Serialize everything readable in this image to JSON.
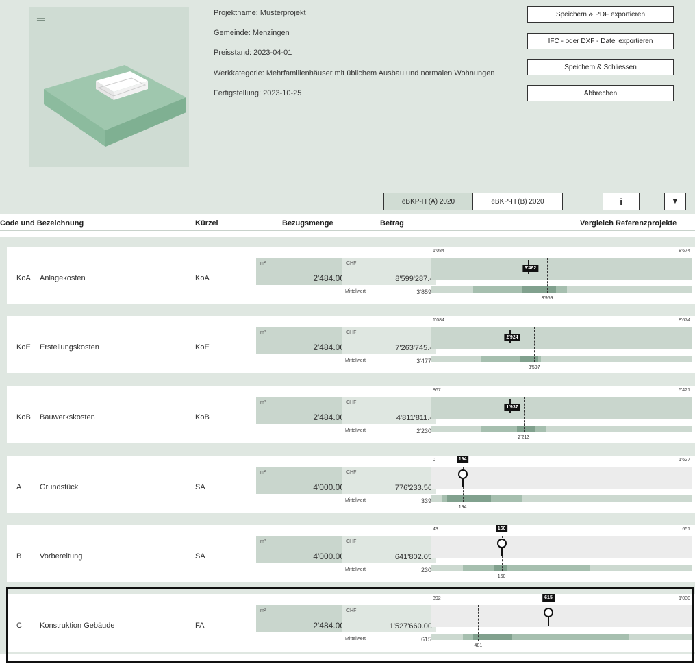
{
  "project": {
    "name_line": "Projektname: Musterprojekt",
    "municipality_line": "Gemeinde: Menzingen",
    "price_line": "Preisstand: 2023-04-01",
    "category_line": "Werkkategorie: Mehrfamilienhäuser mit üblichem Ausbau und normalen Wohnungen",
    "completion_line": "Fertigstellung: 2023-10-25"
  },
  "actions": {
    "save_pdf": "Speichern & PDF exportieren",
    "export_ifc": "IFC - oder DXF - Datei exportieren",
    "save_close": "Speichern & Schliessen",
    "cancel": "Abbrechen"
  },
  "tabs": {
    "a": "eBKP-H (A) 2020",
    "b": "eBKP-H (B) 2020"
  },
  "icons": {
    "info": "i",
    "filter": "▼",
    "menu": "═"
  },
  "columns": {
    "code": "Code und Bezeichnung",
    "abbr": "Kürzel",
    "qty": "Bezugsmenge",
    "amount": "Betrag",
    "compare": "Vergleich Referenzprojekte"
  },
  "rows": [
    {
      "code": "KoA",
      "name": "Anlagekosten",
      "abbr": "KoA",
      "qty_unit": "m²",
      "qty": "2'484.00",
      "currency": "CHF",
      "amount": "8'599'287.-",
      "mean_label": "Mittelwert",
      "mean": "3'859",
      "min": "1'084",
      "max": "8'674",
      "value": "3'462",
      "median": "3'959",
      "style": "bar"
    },
    {
      "code": "KoE",
      "name": "Erstellungskosten",
      "abbr": "KoE",
      "qty_unit": "m²",
      "qty": "2'484.00",
      "currency": "CHF",
      "amount": "7'263'745.-",
      "mean_label": "Mittelwert",
      "mean": "3'477",
      "min": "1'084",
      "max": "8'674",
      "value": "2'924",
      "median": "3'597",
      "style": "bar"
    },
    {
      "code": "KoB",
      "name": "Bauwerkskosten",
      "abbr": "KoB",
      "qty_unit": "m²",
      "qty": "2'484.00",
      "currency": "CHF",
      "amount": "4'811'811.-",
      "mean_label": "Mittelwert",
      "mean": "2'230",
      "min": "867",
      "max": "5'421",
      "value": "1'937",
      "median": "2'213",
      "style": "bar"
    },
    {
      "code": "A",
      "name": "Grundstück",
      "abbr": "SA",
      "qty_unit": "m²",
      "qty": "4'000.00",
      "currency": "CHF",
      "amount": "776'233.56",
      "mean_label": "Mittelwert",
      "mean": "339",
      "min": "0",
      "max": "1'627",
      "value": "194",
      "median": "194",
      "style": "pin"
    },
    {
      "code": "B",
      "name": "Vorbereitung",
      "abbr": "SA",
      "qty_unit": "m²",
      "qty": "4'000.00",
      "currency": "CHF",
      "amount": "641'802.05",
      "mean_label": "Mittelwert",
      "mean": "230",
      "min": "43",
      "max": "651",
      "value": "160",
      "median": "160",
      "style": "pin"
    },
    {
      "code": "C",
      "name": "Konstruktion Gebäude",
      "abbr": "FA",
      "qty_unit": "m²",
      "qty": "2'484.00",
      "currency": "CHF",
      "amount": "1'527'660.00",
      "mean_label": "Mittelwert",
      "mean": "615",
      "min": "392",
      "max": "1'030",
      "value": "615",
      "median": "481",
      "style": "pin"
    }
  ],
  "row_charts": [
    {
      "value_frac": 0.37,
      "median_frac": 0.445,
      "segments": [
        [
          0.16,
          0.52,
          "mid"
        ],
        [
          0.35,
          0.48,
          "dark"
        ]
      ]
    },
    {
      "value_frac": 0.3,
      "median_frac": 0.395,
      "segments": [
        [
          0.19,
          0.42,
          "mid"
        ],
        [
          0.34,
          0.41,
          "dark"
        ]
      ]
    },
    {
      "value_frac": 0.3,
      "median_frac": 0.355,
      "segments": [
        [
          0.19,
          0.44,
          "mid"
        ],
        [
          0.33,
          0.4,
          "dark"
        ]
      ]
    },
    {
      "value_frac": 0.12,
      "median_frac": 0.12,
      "segments": [
        [
          0.04,
          0.35,
          "mid"
        ],
        [
          0.06,
          0.23,
          "dark"
        ]
      ]
    },
    {
      "value_frac": 0.27,
      "median_frac": 0.27,
      "segments": [
        [
          0.12,
          0.61,
          "mid"
        ],
        [
          0.24,
          0.29,
          "dark"
        ]
      ]
    },
    {
      "value_frac": 0.45,
      "median_frac": 0.18,
      "segments": [
        [
          0.12,
          0.76,
          "mid"
        ],
        [
          0.16,
          0.31,
          "dark"
        ]
      ]
    }
  ]
}
